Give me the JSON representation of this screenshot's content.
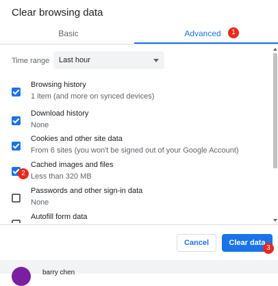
{
  "dialog": {
    "title": "Clear browsing data"
  },
  "tabs": [
    {
      "label": "Basic"
    },
    {
      "label": "Advanced",
      "badge": "1"
    }
  ],
  "time_range": {
    "label": "Time range",
    "value": "Last hour"
  },
  "options": [
    {
      "title": "Browsing history",
      "sub": "1 item (and more on synced devices)",
      "checked": true
    },
    {
      "title": "Download history",
      "sub": "None",
      "checked": true
    },
    {
      "title": "Cookies and other site data",
      "sub": "From 6 sites (you won't be signed out of your Google Account)",
      "checked": true
    },
    {
      "title": "Cached images and files",
      "sub": "Less than 320 MB",
      "checked": true,
      "badge": "2"
    },
    {
      "title": "Passwords and other sign-in data",
      "sub": "None",
      "checked": false
    },
    {
      "title": "Autofill form data",
      "sub": "",
      "checked": false
    }
  ],
  "buttons": {
    "cancel": "Cancel",
    "clear": "Clear data",
    "clear_badge": "3"
  },
  "profile": {
    "name": "barry chen"
  },
  "colors": {
    "accent": "#1a73e8",
    "badge": "#e8291c",
    "avatar": "#7b1fa2"
  }
}
